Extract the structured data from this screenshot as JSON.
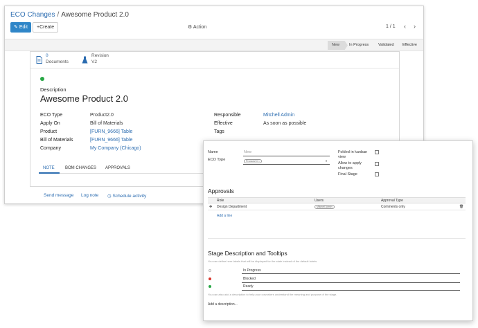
{
  "breadcrumb": {
    "parent": "ECO Changes",
    "separator": "/",
    "current": "Awesome Product 2.0"
  },
  "toolbar": {
    "edit_label": "Edit",
    "create_label": "Create",
    "action_label": "Action",
    "pager": "1 / 1",
    "prev_icon": "chevron-left-icon",
    "next_icon": "chevron-right-icon"
  },
  "stages": [
    "New",
    "In Progress",
    "Validated",
    "Effective"
  ],
  "smart_buttons": {
    "documents": {
      "count": "0",
      "label": "Documents"
    },
    "revision": {
      "label": "Revision",
      "value": "V2"
    }
  },
  "form": {
    "description_label": "Description",
    "title": "Awesome Product 2.0",
    "status_color": "#28a745",
    "left": [
      {
        "label": "ECO Type",
        "value": "Product2.0"
      },
      {
        "label": "Apply On",
        "value": "Bill of Materials"
      },
      {
        "label": "Product",
        "value": "[FURN_9666] Table"
      },
      {
        "label": "Bill of Materials",
        "value": "[FURN_9666] Table"
      },
      {
        "label": "Company",
        "value": "My Company (Chicago)"
      }
    ],
    "right": [
      {
        "label": "Responsible",
        "value": "Mitchell Admin"
      },
      {
        "label": "Effective",
        "value": "As soon as possible"
      },
      {
        "label": "Tags",
        "value": ""
      }
    ],
    "tabs": [
      "NOTE",
      "BOM CHANGES",
      "APPROVALS"
    ]
  },
  "chatter": {
    "send_message": "Send message",
    "log_note": "Log note",
    "schedule_activity": "Schedule activity"
  },
  "stage_dialog": {
    "name_label": "Name",
    "name_value": "New",
    "eco_type_label": "ECO Type",
    "eco_type_tag": "Product2.0",
    "folded_label_1": "Folded in kanban",
    "folded_label_2": "view",
    "allow_label_1": "Allow to apply",
    "allow_label_2": "changes",
    "final_label": "Final Stage",
    "approvals_heading": "Approvals",
    "approvals_columns": [
      "Role",
      "Users",
      "Approval Type"
    ],
    "approvals_rows": [
      {
        "role": "Design Department",
        "users": "Mitchell Admin",
        "type": "Comments only"
      }
    ],
    "add_line": "Add a line",
    "stage_desc_heading": "Stage Description and Tooltips",
    "stage_desc_help": "You can define here labels that will be displayed for the state instead of the default labels.",
    "states": [
      {
        "label": "In Progress",
        "color": "#ffffff"
      },
      {
        "label": "Blocked",
        "color": "#d9342b"
      },
      {
        "label": "Ready",
        "color": "#28a745"
      }
    ],
    "desc_help": "You can also add a description to help your coworkers understand the meaning and purpose of the stage.",
    "add_description": "Add a description..."
  }
}
